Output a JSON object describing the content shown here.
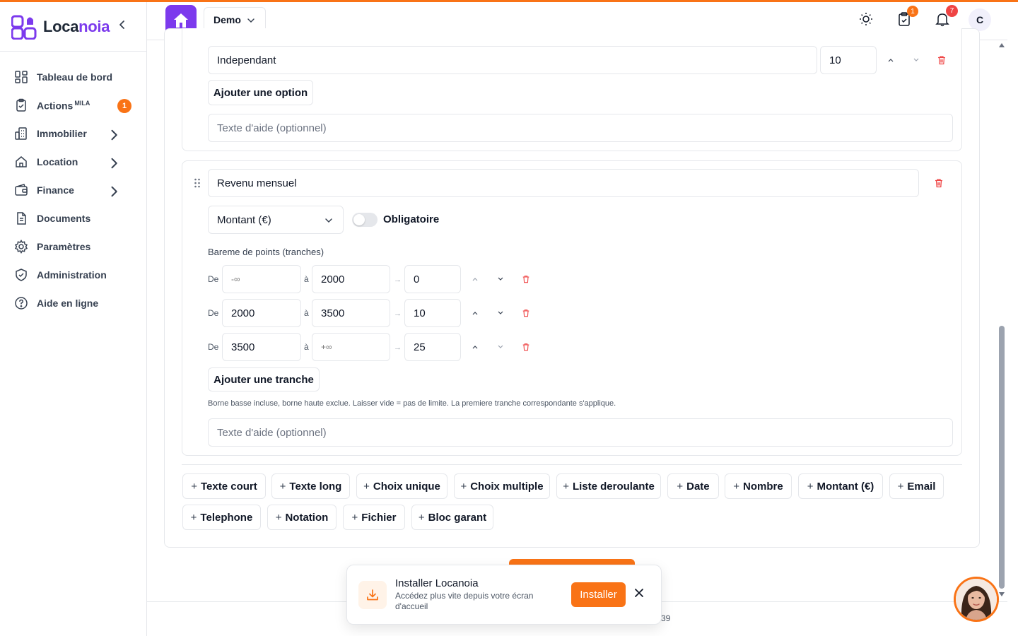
{
  "app": {
    "brand_prefix": "Loca",
    "brand_suffix": "noia",
    "accent": "#f97316",
    "brand_color": "#7c3aed"
  },
  "sidebar": {
    "collapse_icon": "chevron-left-icon",
    "items": [
      {
        "label": "Tableau de bord",
        "icon": "dashboard-icon"
      },
      {
        "label": "Actions",
        "sup": "MILA",
        "icon": "clipboard-check-icon",
        "badge": "1"
      },
      {
        "label": "Immobilier",
        "icon": "building-icon",
        "has_children": true
      },
      {
        "label": "Location",
        "icon": "home-icon",
        "has_children": true
      },
      {
        "label": "Finance",
        "icon": "wallet-icon",
        "has_children": true
      },
      {
        "label": "Documents",
        "icon": "document-icon"
      },
      {
        "label": "Paramètres",
        "icon": "gear-icon"
      },
      {
        "label": "Administration",
        "icon": "shield-icon"
      },
      {
        "label": "Aide en ligne",
        "icon": "help-icon"
      }
    ]
  },
  "header": {
    "workspace": "Demo",
    "tasks_badge": "1",
    "notifications_badge": "7",
    "avatar_initial": "C"
  },
  "option_card": {
    "option_label": "Independant",
    "option_points": "10",
    "add_option_label": "Ajouter une option",
    "help_placeholder": "Texte d'aide (optionnel)"
  },
  "field_card": {
    "title": "Revenu mensuel",
    "type_select": "Montant (€)",
    "required_label": "Obligatoire",
    "required_on": false,
    "scale_label": "Bareme de points (tranches)",
    "from_label": "De",
    "to_label": "à",
    "arrow": "→",
    "ranges": [
      {
        "from": "",
        "from_placeholder": "-∞",
        "to": "2000",
        "to_placeholder": "",
        "points": "0"
      },
      {
        "from": "2000",
        "from_placeholder": "",
        "to": "3500",
        "to_placeholder": "",
        "points": "10"
      },
      {
        "from": "3500",
        "from_placeholder": "",
        "to": "",
        "to_placeholder": "+∞",
        "points": "25"
      }
    ],
    "add_range_label": "Ajouter une tranche",
    "hint": "Borne basse incluse, borne haute exclue. Laisser vide = pas de limite. La premiere tranche correspondante s'applique.",
    "help_placeholder": "Texte d'aide (optionnel)"
  },
  "add_field_buttons": {
    "plus": "+",
    "labels": [
      "Texte court",
      "Texte long",
      "Choix unique",
      "Choix multiple",
      "Liste deroulante",
      "Date",
      "Nombre",
      "Montant (€)",
      "Email",
      "Telephone",
      "Notation",
      "Fichier",
      "Bloc garant"
    ]
  },
  "footer": {
    "partial_text": "39"
  },
  "install_popup": {
    "title": "Installer Locanoia",
    "subtitle": "Accédez plus vite depuis votre écran d'accueil",
    "install_label": "Installer"
  }
}
